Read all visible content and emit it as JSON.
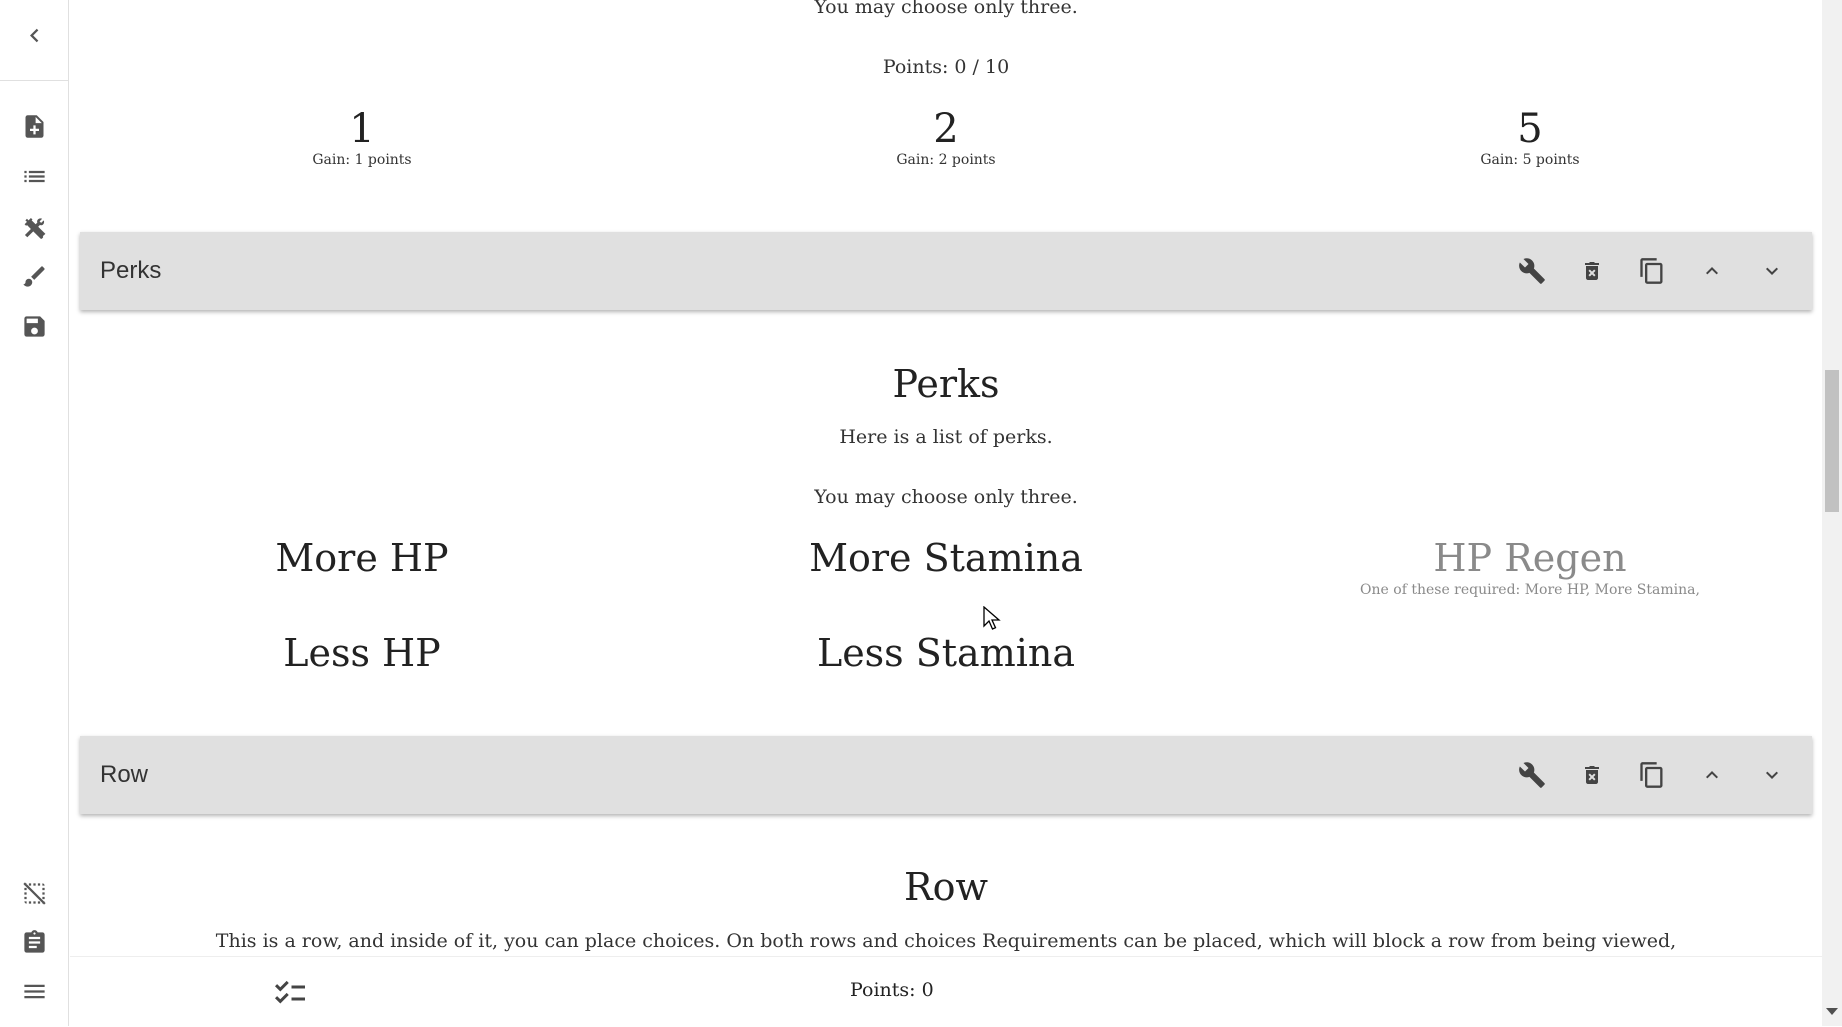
{
  "rail": {
    "top_icons": [
      "chevron-left-icon",
      "note-add-icon",
      "list-icon",
      "tools-icon",
      "brush-icon",
      "save-icon"
    ],
    "bottom_icons": [
      "selection-off-icon",
      "clipboard-icon",
      "menu-icon"
    ]
  },
  "prev_row": {
    "line": "You may choose only three.",
    "points": "Points: 0 / 10",
    "choices": [
      {
        "title": "1",
        "sub": "Gain: 1 points"
      },
      {
        "title": "2",
        "sub": "Gain: 2 points"
      },
      {
        "title": "5",
        "sub": "Gain: 5 points"
      }
    ]
  },
  "perks_row": {
    "header_title": "Perks",
    "title": "Perks",
    "text1": "Here is a list of perks.",
    "text2": "You may choose only three.",
    "choices": [
      {
        "title": "More HP"
      },
      {
        "title": "More Stamina"
      },
      {
        "title": "HP Regen",
        "requirement": "One of these required: More HP, More Stamina,"
      },
      {
        "title": "Less HP"
      },
      {
        "title": "Less Stamina"
      }
    ]
  },
  "row_row": {
    "header_title": "Row",
    "title": "Row",
    "text": "This is a row, and inside of it, you can place choices. On both rows and choices Requirements can be placed, which will block a row from being viewed,"
  },
  "header_buttons": [
    "wrench-icon",
    "delete-icon",
    "copy-icon",
    "chevron-up-icon",
    "chevron-down-icon"
  ],
  "bottom_bar": {
    "points": "Points: 0"
  },
  "colors": {
    "header_bg": "#e0e0e0",
    "disabled_text": "#8a8a8a"
  }
}
